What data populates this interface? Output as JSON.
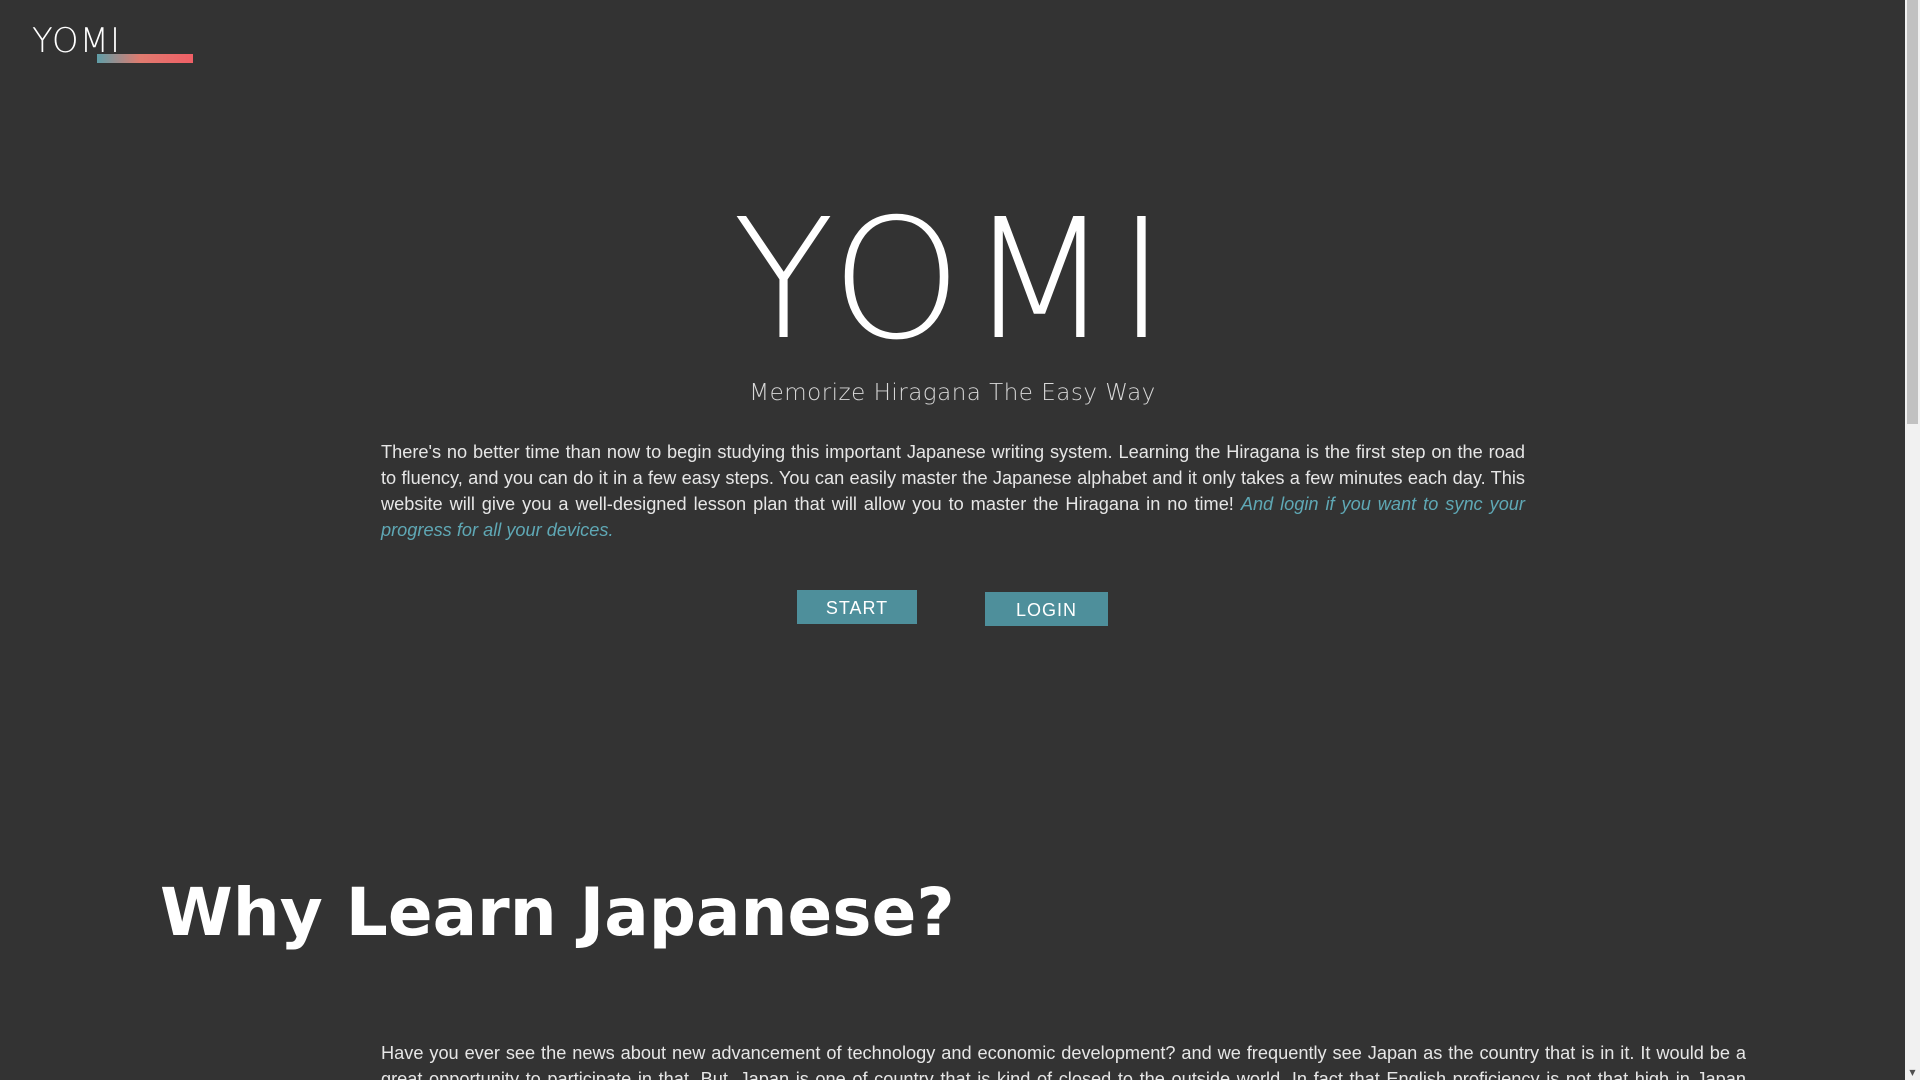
{
  "header": {
    "logo_text": "YOMI"
  },
  "hero": {
    "title": "YOMI",
    "subtitle": "Memorize Hiragana The Easy Way",
    "body": "There's no better time than now to begin studying this important Japanese writing system. Learning the Hiragana is the first step on the road to fluency, and you can do it in a few easy steps. You can easily master the Japanese alphabet and it only takes a few minutes each day. This website will give you a well-designed lesson plan that will allow you to master the Hiragana in no time! ",
    "body_highlight": "And login if you want to sync your progress for all your devices.",
    "start_label": "START",
    "login_label": "LOGIN"
  },
  "why": {
    "title": "Why Learn Japanese?",
    "body": "Have you ever see the news about new advancement of technology and economic development? and we frequently see Japan as the country that is in it. It would be a great opportunity to participate in that. But, Japan is one of country that is kind of closed to the outside world. In fact that English proficiency is not that high in Japan because the people won't even bother to"
  },
  "scrollbar": {
    "up_icon": "▲",
    "down_icon": "▼"
  },
  "colors": {
    "background": "#333333",
    "accent": "#4e8f9b",
    "highlight_text": "#5fa8b5",
    "logo_bar_start": "#5f9ea8",
    "logo_bar_end": "#f05f66"
  }
}
